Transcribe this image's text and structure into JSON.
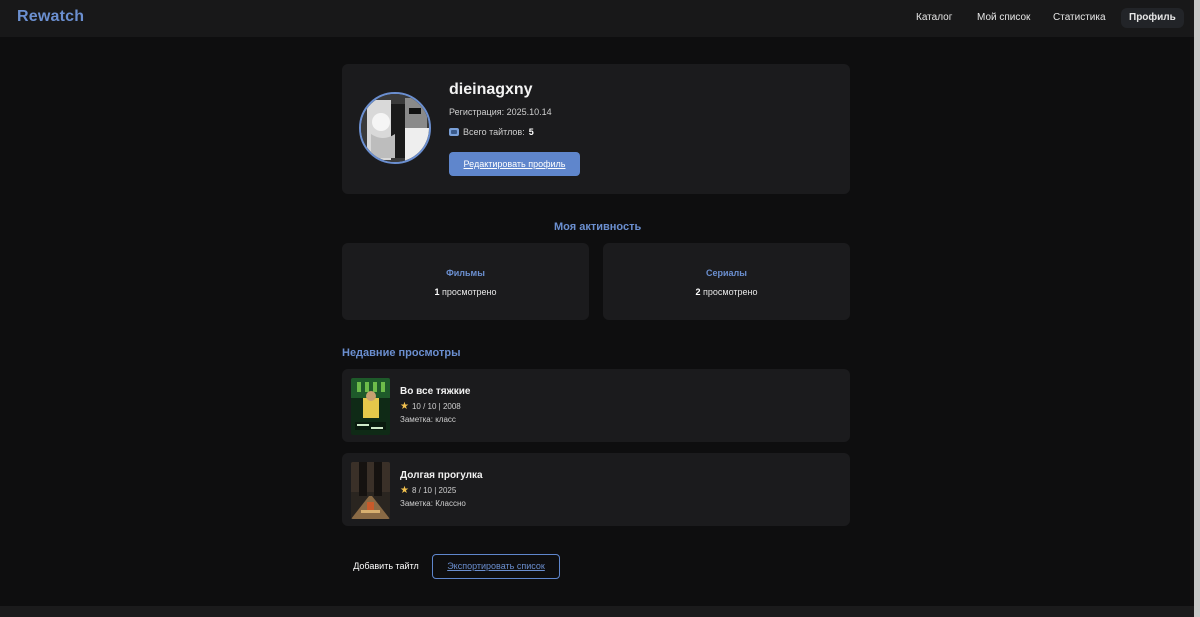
{
  "app": {
    "brand": "Rewatch"
  },
  "nav": {
    "items": [
      {
        "label": "Каталог"
      },
      {
        "label": "Мой список"
      },
      {
        "label": "Статистика"
      },
      {
        "label": "Профиль"
      }
    ],
    "active_index": 3
  },
  "profile": {
    "username": "dieinagxny",
    "registration_label": "Регистрация:",
    "registration_date": "2025.10.14",
    "total_label": "Всего тайтлов:",
    "total_count": "5",
    "edit_button": "Редактировать профиль"
  },
  "activity": {
    "title": "Моя активность",
    "cards": [
      {
        "title": "Фильмы",
        "count": "1",
        "suffix": "просмотрено"
      },
      {
        "title": "Сериалы",
        "count": "2",
        "suffix": "просмотрено"
      }
    ]
  },
  "recent": {
    "title": "Недавние просмотры",
    "items": [
      {
        "title": "Во все тяжкие",
        "rating": "10 / 10 | 2008",
        "note": "Заметка: класс"
      },
      {
        "title": "Долгая прогулка",
        "rating": "8 / 10 | 2025",
        "note": "Заметка: Классно"
      }
    ]
  },
  "actions": {
    "add_title": "Добавить тайтл",
    "export_list": "Экспортировать список"
  },
  "colors": {
    "accent": "#6b8fd0",
    "button": "#5f86cc",
    "star": "#f2c14e"
  },
  "icons": [
    "tv-icon",
    "star-icon"
  ]
}
